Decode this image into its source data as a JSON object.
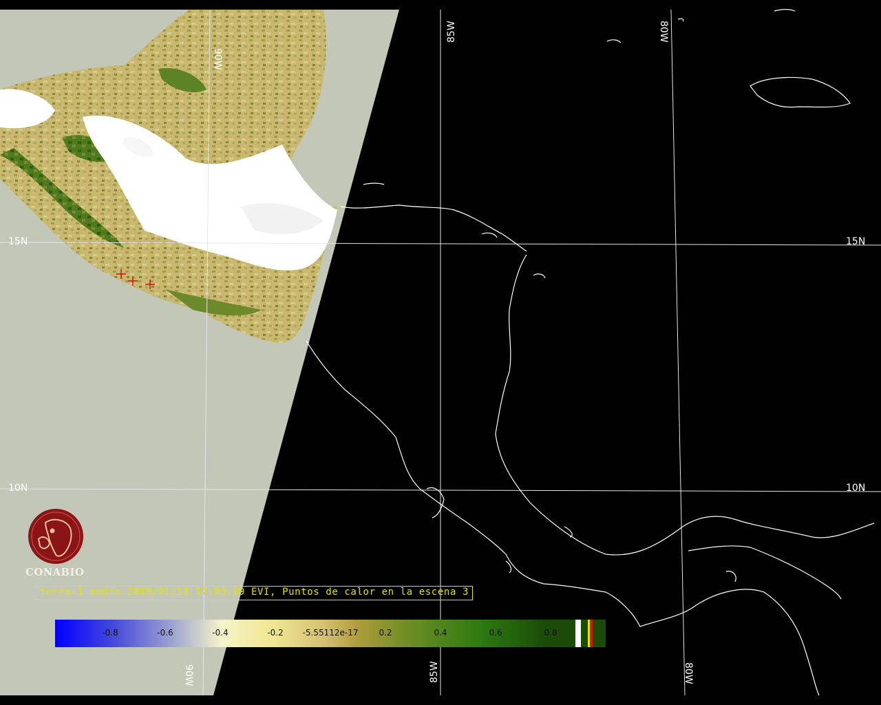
{
  "map": {
    "grid_labels": {
      "lon_top": [
        "90W",
        "85W",
        "80W"
      ],
      "lon_bottom": [
        "90W",
        "85W",
        "80W"
      ],
      "lat_left": [
        "15N",
        "10N"
      ],
      "lat_right": [
        "15N",
        "10N"
      ]
    },
    "hotspot_count": 3,
    "colors": {
      "no_data_swath": "#c3c7b7",
      "background": "#000000",
      "coastline": "#ffffff",
      "hotspot": "#cc1a1a",
      "caption": "#e8e000"
    }
  },
  "caption": {
    "text": "terra-1 modis 2009/01/18 17:05:09 EVI, Puntos de calor en la escena 3"
  },
  "logo": {
    "text": "CONABIO",
    "icon": "conabio-macaw-logo"
  },
  "colorbar": {
    "labels": [
      "-0.8",
      "-0.6",
      "-0.4",
      "-0.2",
      "-5.55112e-17",
      "0.2",
      "0.4",
      "0.6",
      "0.8"
    ],
    "values": [
      -0.8,
      -0.6,
      -0.4,
      -0.2,
      0,
      0.2,
      0.4,
      0.6,
      0.8
    ],
    "range": [
      -1,
      1
    ]
  }
}
